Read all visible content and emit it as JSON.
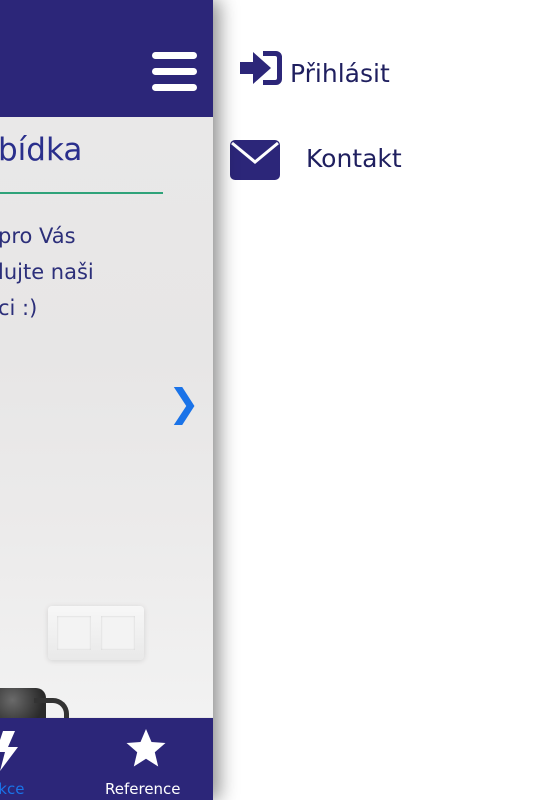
{
  "main": {
    "section_title": "bídka",
    "intro_text": "pro Vás\nlujte naši\nci :)",
    "carousel_next": "❯"
  },
  "tabs": [
    {
      "label": "Akce",
      "icon": "bolt-icon",
      "active": true
    },
    {
      "label": "Reference",
      "icon": "star-icon",
      "active": false
    }
  ],
  "menu": {
    "login_label": "Přihlásit",
    "login_icon": "sign-in-icon",
    "contact_label": "Kontakt",
    "contact_icon": "envelope-icon"
  },
  "colors": {
    "header": "#2c2679",
    "menu_text": "#1f1f5f",
    "accent_link": "#1a73e8",
    "underline": "#2fa37a"
  }
}
